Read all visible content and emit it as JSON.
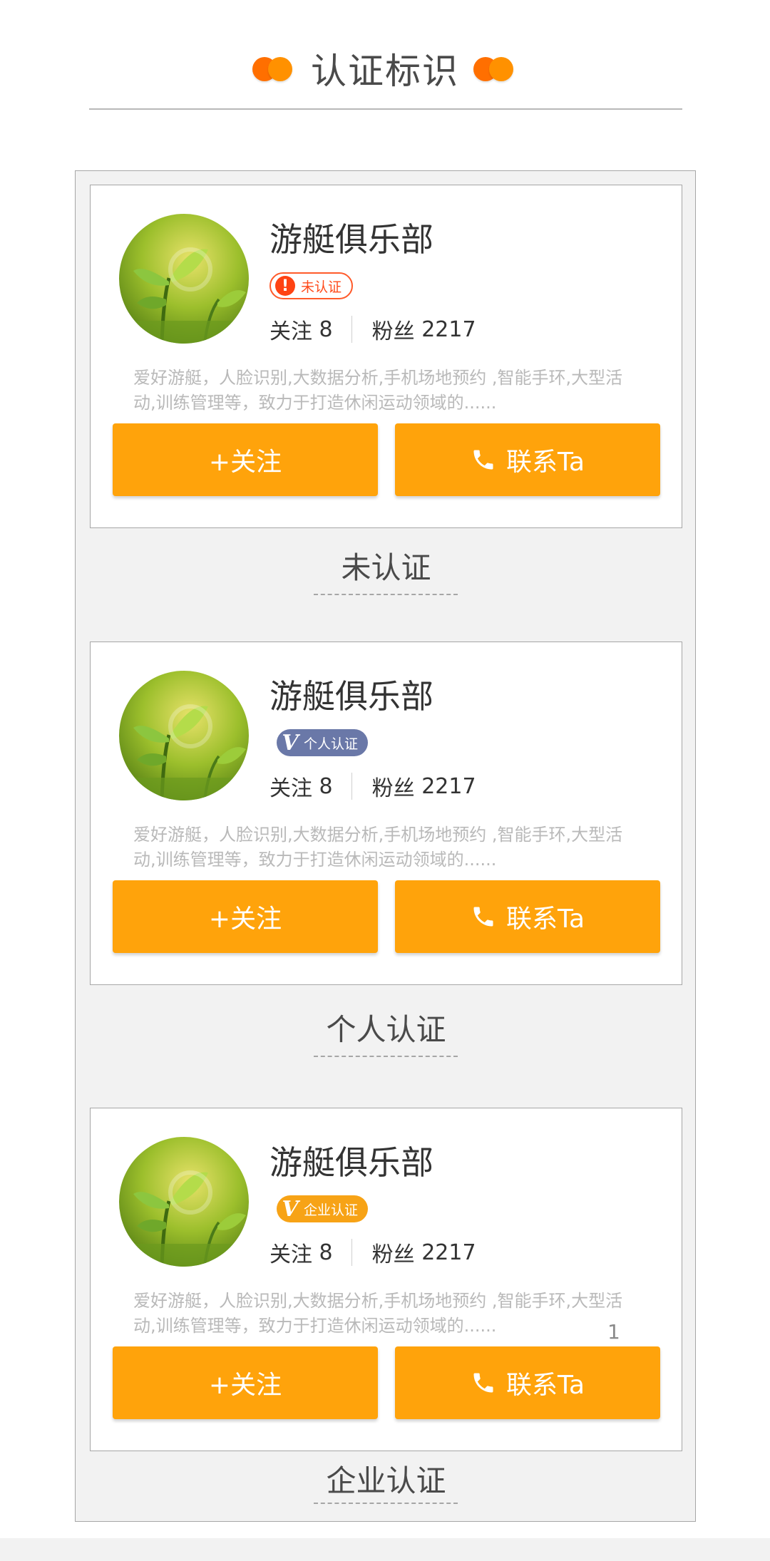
{
  "header": {
    "title": "认证标识"
  },
  "colors": {
    "accent": "#ffa30b",
    "unverified": "#ff4313",
    "personal": "#6a78a8",
    "enterprise": "#f7a316"
  },
  "cards": [
    {
      "name": "游艇俱乐部",
      "badge": {
        "type": "unverified",
        "icon": "exclamation-icon",
        "label": "未认证"
      },
      "following_label": "关注",
      "following_count": "8",
      "fans_label": "粉丝",
      "fans_count": "2217",
      "description": "爱好游艇，人脸识别,大数据分析,手机场地预约 ,智能手环,大型活动,训练管理等，致力于打造休闲运动领域的......",
      "follow_button": "+关注",
      "contact_button": "联系Ta",
      "caption": "未认证"
    },
    {
      "name": "游艇俱乐部",
      "badge": {
        "type": "personal",
        "icon": "v-icon",
        "label": "个人认证"
      },
      "following_label": "关注",
      "following_count": "8",
      "fans_label": "粉丝",
      "fans_count": "2217",
      "description": "爱好游艇，人脸识别,大数据分析,手机场地预约 ,智能手环,大型活动,训练管理等，致力于打造休闲运动领域的......",
      "follow_button": "+关注",
      "contact_button": "联系Ta",
      "caption": "个人认证"
    },
    {
      "name": "游艇俱乐部",
      "badge": {
        "type": "enterprise",
        "icon": "v-icon",
        "label": "企业认证"
      },
      "following_label": "关注",
      "following_count": "8",
      "fans_label": "粉丝",
      "fans_count": "2217",
      "description": "爱好游艇，人脸识别,大数据分析,手机场地预约 ,智能手环,大型活动,训练管理等，致力于打造休闲运动领域的......",
      "follow_button": "+关注",
      "contact_button": "联系Ta",
      "caption": "企业认证",
      "page_number": "1"
    }
  ]
}
